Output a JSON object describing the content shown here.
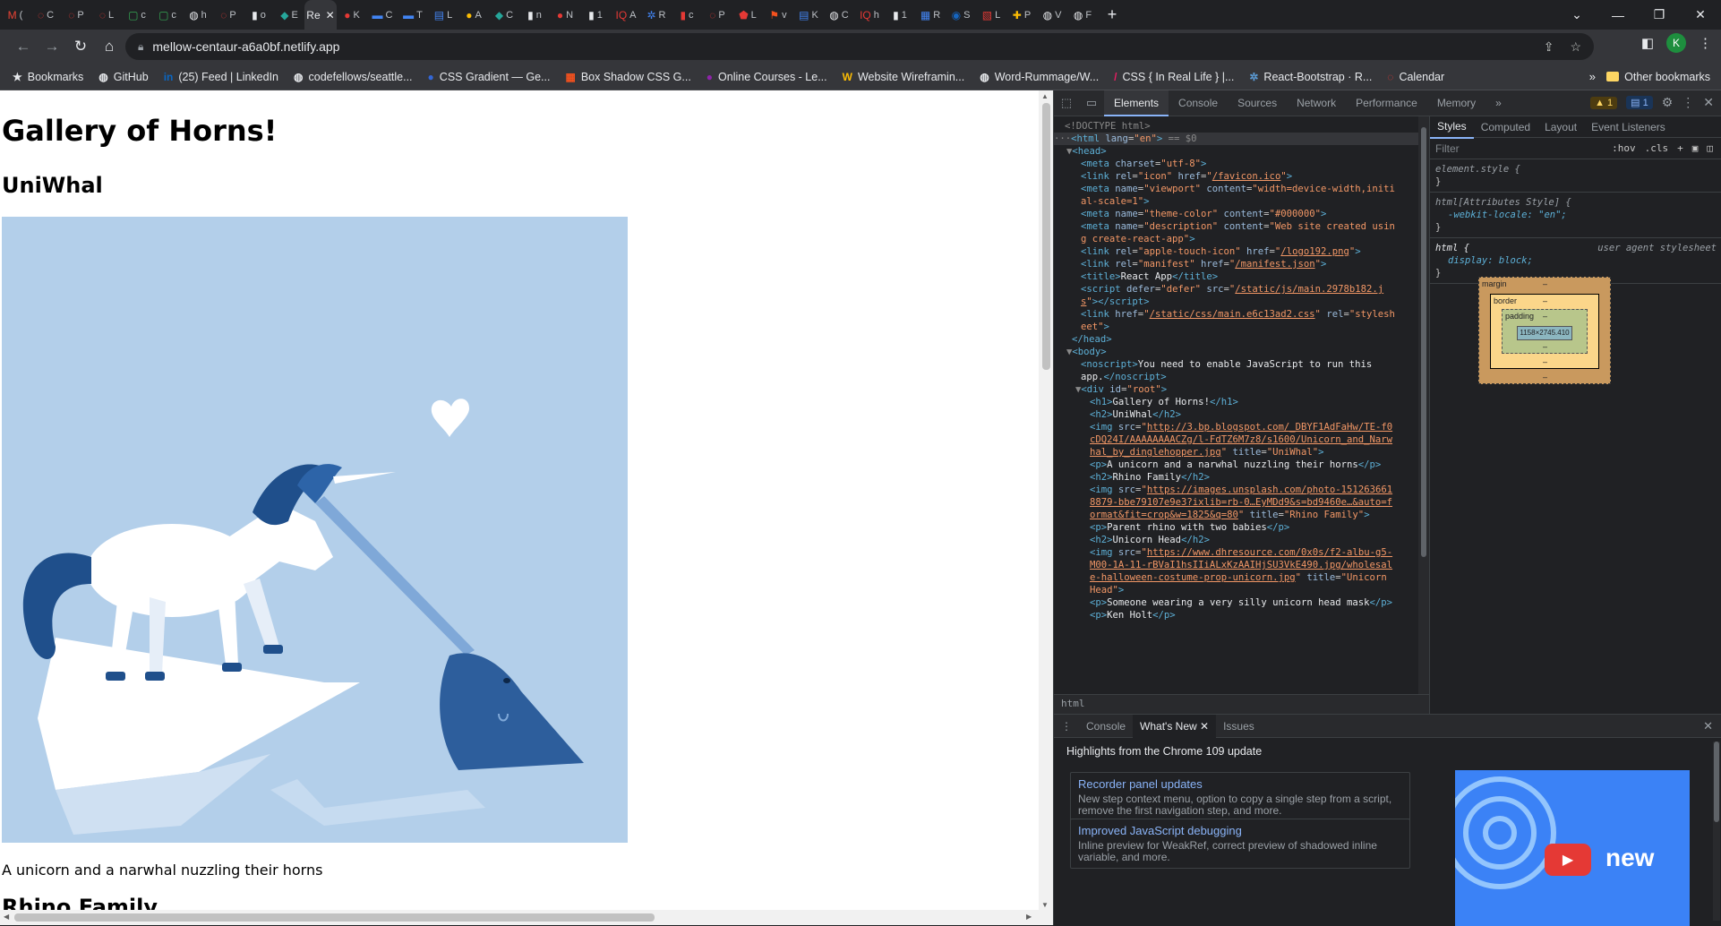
{
  "browser": {
    "tabs": [
      {
        "glyph": "M",
        "title": "(",
        "color": "#ea4335"
      },
      {
        "glyph": "◌",
        "title": "C",
        "color": "#e53935"
      },
      {
        "glyph": "◌",
        "title": "P",
        "color": "#e53935"
      },
      {
        "glyph": "◌",
        "title": "L",
        "color": "#e53935"
      },
      {
        "glyph": "▢",
        "title": "c",
        "color": "#34a853"
      },
      {
        "glyph": "▢",
        "title": "c",
        "color": "#34a853"
      },
      {
        "glyph": "◍",
        "title": "h",
        "color": "#e8eaed"
      },
      {
        "glyph": "◌",
        "title": "P",
        "color": "#e53935"
      },
      {
        "glyph": "▮",
        "title": "o",
        "color": "#e8eaed"
      },
      {
        "glyph": "◆",
        "title": "E",
        "color": "#26a69a"
      },
      {
        "glyph": "Re",
        "title": "",
        "color": "#e8eaed",
        "active": true
      },
      {
        "glyph": "●",
        "title": "K",
        "color": "#e53935"
      },
      {
        "glyph": "▬",
        "title": "C",
        "color": "#4285f4"
      },
      {
        "glyph": "▬",
        "title": "T",
        "color": "#4285f4"
      },
      {
        "glyph": "▤",
        "title": "L",
        "color": "#4285f4"
      },
      {
        "glyph": "●",
        "title": "A",
        "color": "#fbbc04"
      },
      {
        "glyph": "◆",
        "title": "C",
        "color": "#26a69a"
      },
      {
        "glyph": "▮",
        "title": "n",
        "color": "#e8eaed"
      },
      {
        "glyph": "●",
        "title": "N",
        "color": "#e53935"
      },
      {
        "glyph": "▮",
        "title": "1",
        "color": "#e8eaed"
      },
      {
        "glyph": "IQ",
        "title": "A",
        "color": "#e53935"
      },
      {
        "glyph": "✲",
        "title": "R",
        "color": "#4285f4"
      },
      {
        "glyph": "▮",
        "title": "c",
        "color": "#e53935"
      },
      {
        "glyph": "◌",
        "title": "P",
        "color": "#e53935"
      },
      {
        "glyph": "⬟",
        "title": "L",
        "color": "#e53935"
      },
      {
        "glyph": "⚑",
        "title": "v",
        "color": "#f4511e"
      },
      {
        "glyph": "▤",
        "title": "K",
        "color": "#4285f4"
      },
      {
        "glyph": "◍",
        "title": "C",
        "color": "#e8eaed"
      },
      {
        "glyph": "IQ",
        "title": "h",
        "color": "#e53935"
      },
      {
        "glyph": "▮",
        "title": "1",
        "color": "#e8eaed"
      },
      {
        "glyph": "▦",
        "title": "R",
        "color": "#4285f4"
      },
      {
        "glyph": "◉",
        "title": "S",
        "color": "#1565c0"
      },
      {
        "glyph": "▧",
        "title": "L",
        "color": "#e53935"
      },
      {
        "glyph": "✚",
        "title": "P",
        "color": "#fbbc04"
      },
      {
        "glyph": "◍",
        "title": "V",
        "color": "#e8eaed"
      },
      {
        "glyph": "◍",
        "title": "F",
        "color": "#e8eaed"
      }
    ],
    "new_tab": "+",
    "url": "mellow-centaur-a6a0bf.netlify.app",
    "bookmarks": [
      {
        "label": "Bookmarks",
        "color": "#e8eaed",
        "glyph": "★"
      },
      {
        "label": "GitHub",
        "color": "#e8eaed",
        "glyph": "◍"
      },
      {
        "label": "(25) Feed | LinkedIn",
        "color": "#0a66c2",
        "glyph": "in"
      },
      {
        "label": "codefellows/seattle...",
        "color": "#e8eaed",
        "glyph": "◍"
      },
      {
        "label": "CSS Gradient — Ge...",
        "color": "#3367d6",
        "glyph": "●"
      },
      {
        "label": "Box Shadow CSS G...",
        "color": "#f4511e",
        "glyph": "▦"
      },
      {
        "label": "Online Courses - Le...",
        "color": "#8e24aa",
        "glyph": "●"
      },
      {
        "label": "Website Wireframin...",
        "color": "#fbbc04",
        "glyph": "W"
      },
      {
        "label": "Word-Rummage/W...",
        "color": "#e8eaed",
        "glyph": "◍"
      },
      {
        "label": "CSS { In Real Life } |...",
        "color": "#e91e63",
        "glyph": "/"
      },
      {
        "label": "React-Bootstrap · R...",
        "color": "#5b9bd5",
        "glyph": "✲"
      },
      {
        "label": "Calendar",
        "color": "#e53935",
        "glyph": "◌"
      }
    ],
    "bookmarks_more": "»",
    "other_bookmarks": "Other bookmarks",
    "profile_initial": "K"
  },
  "page": {
    "title": "Gallery of Horns!",
    "subtitle": "UniWhal",
    "caption": "A unicorn and a narwhal nuzzling their horns",
    "next_heading": "Rhino Family"
  },
  "devtools": {
    "tabs": [
      "Elements",
      "Console",
      "Sources",
      "Network",
      "Performance",
      "Memory"
    ],
    "more": "»",
    "warn_count": "▲ 1",
    "msg_count": "▤ 1",
    "breadcrumb": "html",
    "styles_tabs": [
      "Styles",
      "Computed",
      "Layout",
      "Event Listeners"
    ],
    "filter_placeholder": "Filter",
    "filter_hov": ":hov",
    "filter_cls": ".cls",
    "rules": {
      "element_style": "element.style {",
      "attr_sel": "html[Attributes Style] {",
      "attr_prop": "-webkit-locale: \"en\";",
      "html_sel": "html {",
      "html_src": "user agent stylesheet",
      "html_prop": "display: block;",
      "close": "}"
    },
    "box_model": {
      "margin": "margin",
      "border": "border",
      "padding": "padding",
      "content": "1158×2745.410",
      "dash": "–"
    },
    "drawer": {
      "tabs": [
        "Console",
        "What's New",
        "Issues"
      ],
      "headline": "Highlights from the Chrome 109 update",
      "cards": [
        {
          "title": "Recorder panel updates",
          "desc": "New step context menu, option to copy a single step from a script, remove the first navigation step, and more."
        },
        {
          "title": "Improved JavaScript debugging",
          "desc": "Inline preview for WeakRef, correct preview of shadowed inline variable, and more."
        }
      ],
      "promo_word": "new"
    }
  }
}
